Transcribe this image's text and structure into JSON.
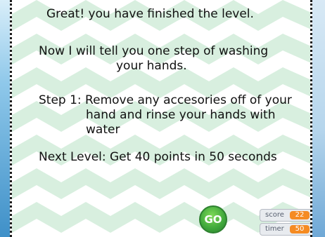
{
  "message": {
    "line1": "Great! you have finished the level.",
    "line2": "Now I will tell you one step of washing",
    "line3": "your hands.",
    "line4": "Step 1: Remove any accesories off of your",
    "line5": "hand and rinse your hands with",
    "line6": "water",
    "line7": "Next Level: Get 40 points in 50 seconds"
  },
  "go_button": {
    "label": "GO"
  },
  "hud": {
    "score_label": "score",
    "score_value": "22",
    "timer_label": "timer",
    "timer_value": "50"
  },
  "colors": {
    "chevron": "#d8efdf",
    "go": "#3ea73b",
    "badge": "#f58b22",
    "panel_border": "#1c1c1c"
  }
}
